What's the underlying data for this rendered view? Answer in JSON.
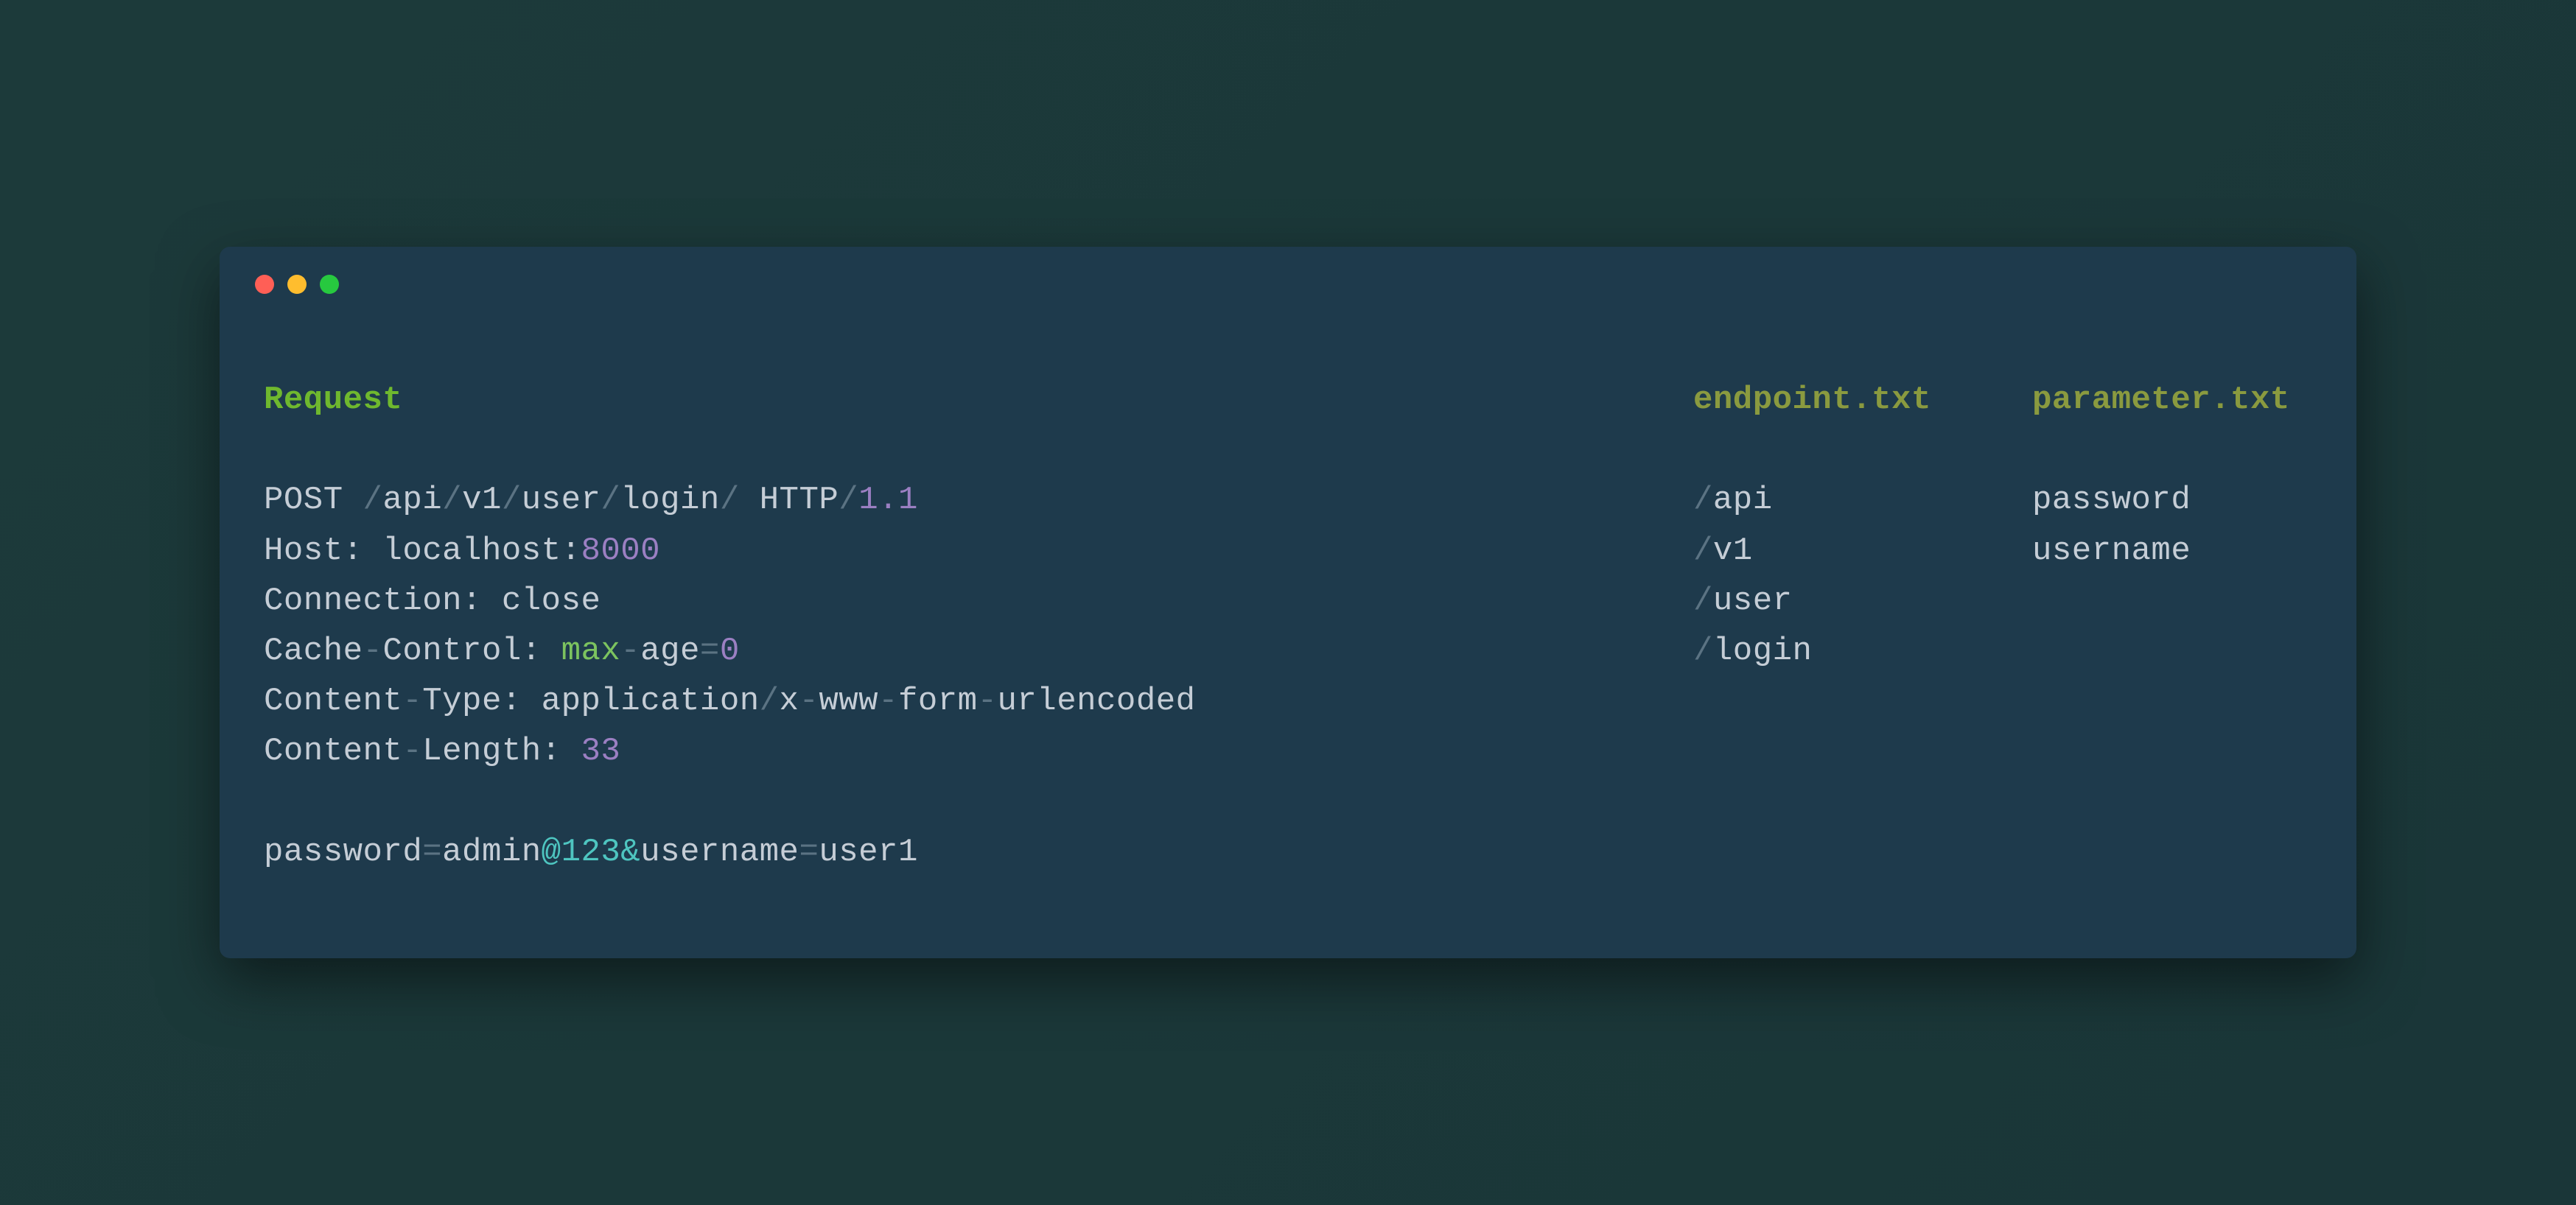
{
  "headings": {
    "request": "Request",
    "endpoint": "endpoint.txt",
    "parameter": "parameter.txt"
  },
  "req": {
    "method": "POST ",
    "slash1": "/",
    "p1": "api",
    "slash2": "/",
    "p2": "v1",
    "slash3": "/",
    "p3": "user",
    "slash4": "/",
    "p4": "login",
    "slash5": "/",
    "http_word": " HTTP",
    "slash6": "/",
    "version": "1.1",
    "host_label": "Host: localhost:",
    "host_port": "8000",
    "connection": "Connection: close",
    "cache_label": "Cache",
    "dash1": "-",
    "control_label": "Control: ",
    "max": "max",
    "dash2": "-",
    "age": "age",
    "eq1": "=",
    "zero": "0",
    "ct_content": "Content",
    "ct_dash1": "-",
    "ct_type": "Type: application",
    "ct_slash": "/",
    "ct_x": "x",
    "ct_dash2": "-",
    "ct_www": "www",
    "ct_dash3": "-",
    "ct_form": "form",
    "ct_dash4": "-",
    "ct_urlencoded": "urlencoded",
    "cl_content": "Content",
    "cl_dash": "-",
    "cl_length": "Length: ",
    "cl_num": "33",
    "body_password": "password",
    "body_eq1": "=",
    "body_admin": "admin",
    "body_at": "@123&",
    "body_username": "username",
    "body_eq2": "=",
    "body_user1": "user1"
  },
  "endpoint": {
    "slash_a": "/",
    "api": "api",
    "slash_b": "/",
    "v1": "v1",
    "slash_c": "/",
    "user": "user",
    "slash_d": "/",
    "login": "login"
  },
  "parameter": {
    "password": "password",
    "username": "username"
  }
}
